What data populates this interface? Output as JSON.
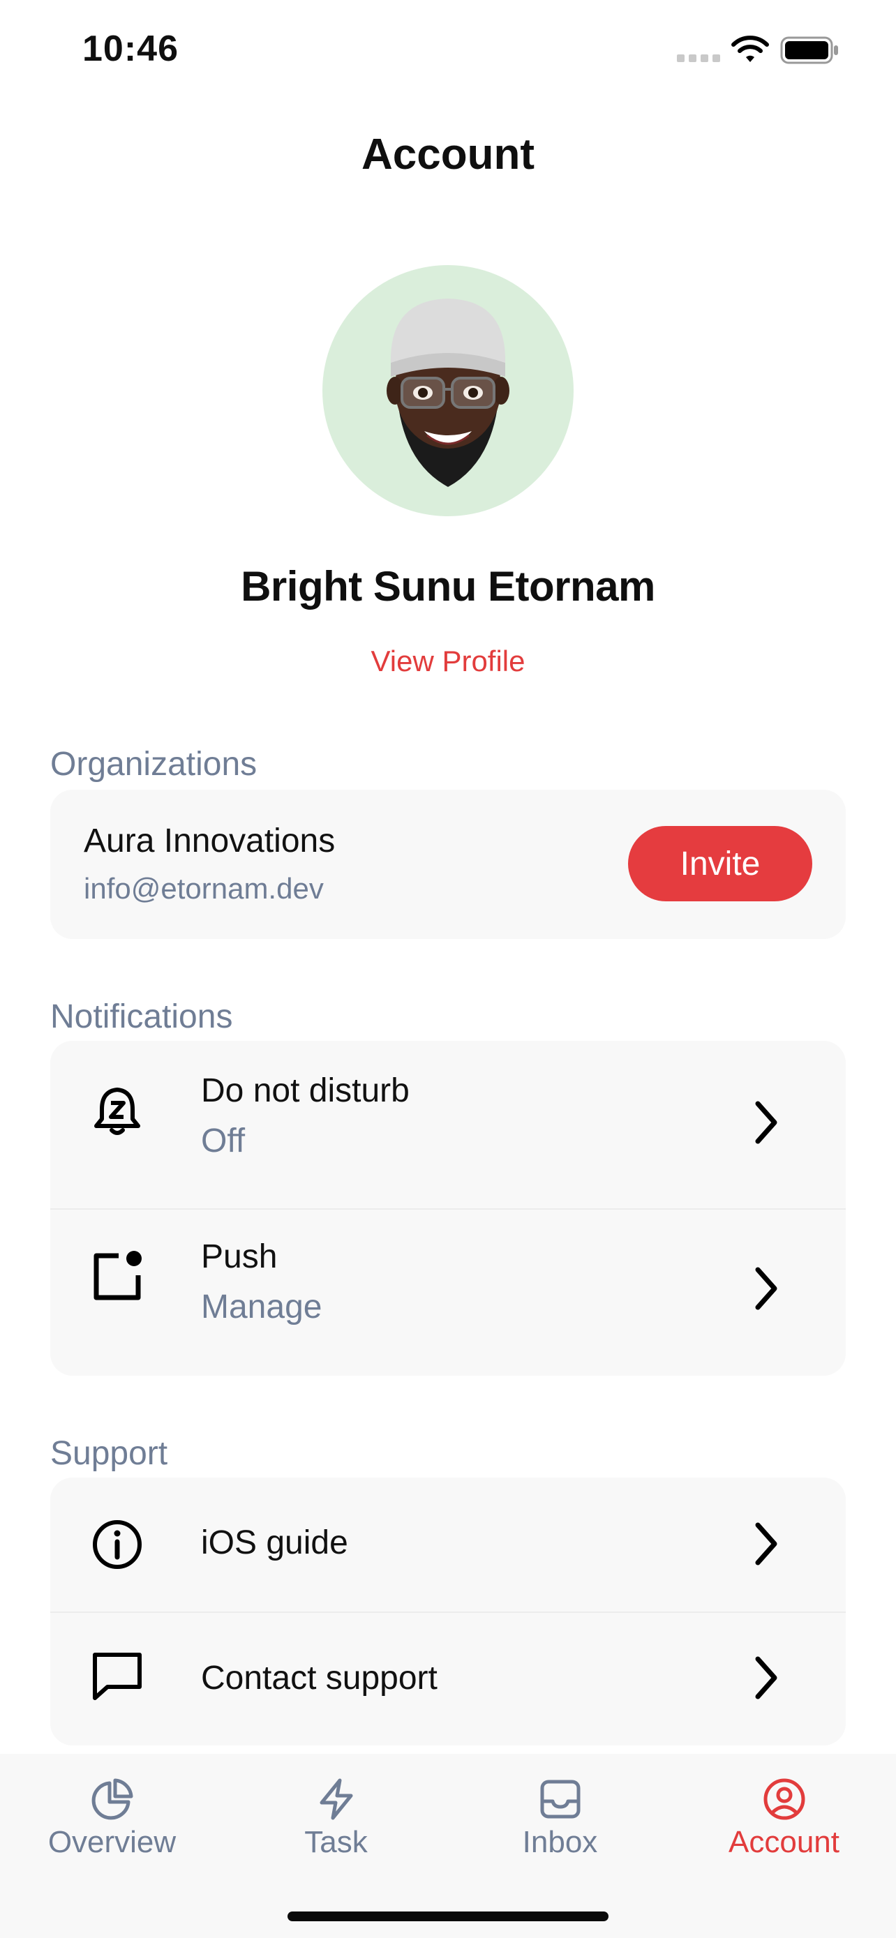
{
  "status_bar": {
    "time": "10:46"
  },
  "header": {
    "title": "Account"
  },
  "profile": {
    "name": "Bright Sunu Etornam",
    "view_profile_label": "View Profile"
  },
  "organizations": {
    "section_title": "Organizations",
    "org_name": "Aura Innovations",
    "org_email": "info@etornam.dev",
    "invite_label": "Invite"
  },
  "notifications": {
    "section_title": "Notifications",
    "items": [
      {
        "icon": "bell-snooze-icon",
        "label": "Do not disturb",
        "value": "Off"
      },
      {
        "icon": "notification-badge-icon",
        "label": "Push",
        "value": "Manage"
      }
    ]
  },
  "support": {
    "section_title": "Support",
    "items": [
      {
        "icon": "info-icon",
        "label": "iOS guide"
      },
      {
        "icon": "chat-bubble-icon",
        "label": "Contact support"
      }
    ]
  },
  "tabbar": {
    "tabs": [
      {
        "icon": "pie-chart-icon",
        "label": "Overview",
        "active": false
      },
      {
        "icon": "lightning-icon",
        "label": "Task",
        "active": false
      },
      {
        "icon": "inbox-icon",
        "label": "Inbox",
        "active": false
      },
      {
        "icon": "user-circle-icon",
        "label": "Account",
        "active": true
      }
    ]
  },
  "colors": {
    "accent": "#e53c3f",
    "muted": "#6f7d95",
    "card": "#f8f8f8",
    "avatar_bg": "#daeedb"
  }
}
